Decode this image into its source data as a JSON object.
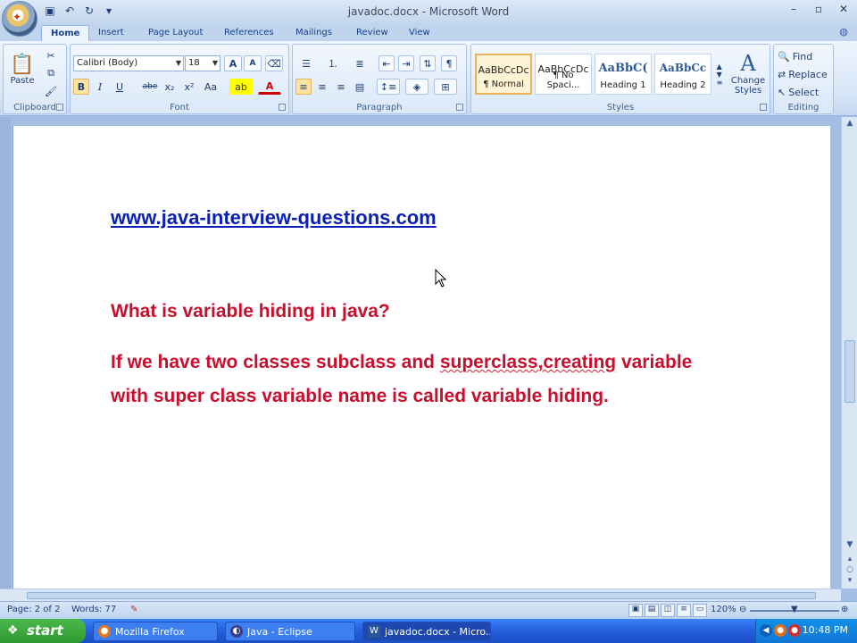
{
  "window": {
    "title": "javadoc.docx - Microsoft Word"
  },
  "quick_access": {
    "icons": [
      "save-icon",
      "undo-icon",
      "redo-icon",
      "customize-icon"
    ]
  },
  "tabs": [
    {
      "label": "Home",
      "active": true
    },
    {
      "label": "Insert"
    },
    {
      "label": "Page Layout"
    },
    {
      "label": "References"
    },
    {
      "label": "Mailings"
    },
    {
      "label": "Review"
    },
    {
      "label": "View"
    }
  ],
  "ribbon": {
    "clipboard": {
      "label": "Clipboard",
      "paste_label": "Paste"
    },
    "font": {
      "label": "Font",
      "font_name": "Calibri (Body)",
      "font_size": "18",
      "buttons": [
        "B",
        "I",
        "U",
        "abe",
        "x₂",
        "x²",
        "Aa",
        "A",
        "A"
      ]
    },
    "paragraph": {
      "label": "Paragraph"
    },
    "styles": {
      "label": "Styles",
      "items": [
        {
          "sample": "AaBbCcDc",
          "name": "¶ Normal",
          "selected": true
        },
        {
          "sample": "AaBbCcDc",
          "name": "¶ No Spaci..."
        },
        {
          "sample": "AaBbC(",
          "name": "Heading 1"
        },
        {
          "sample": "AaBbCc",
          "name": "Heading 2"
        }
      ],
      "change_styles_label": "Change Styles"
    },
    "editing": {
      "label": "Editing",
      "find_label": "Find",
      "replace_label": "Replace",
      "select_label": "Select"
    }
  },
  "document": {
    "link": "www.java-interview-questions.com",
    "question": "What is variable hiding in java?",
    "answer_part1": "If we have two classes subclass and ",
    "answer_misspelled": "superclass,creating",
    "answer_part2": " variable with super class variable name is called variable hiding.",
    "text_color": "#c8102e",
    "link_color": "#0a1fb5"
  },
  "statusbar": {
    "page": "Page: 2 of 2",
    "words": "Words: 77",
    "zoom": "120%"
  },
  "taskbar": {
    "start_label": "start",
    "tasks": [
      {
        "label": "Mozilla Firefox",
        "icon": "firefox-icon"
      },
      {
        "label": "Java - Eclipse",
        "icon": "eclipse-icon"
      },
      {
        "label": "javadoc.docx - Micro...",
        "icon": "word-icon",
        "active": true
      }
    ],
    "clock": "10:48 PM"
  }
}
